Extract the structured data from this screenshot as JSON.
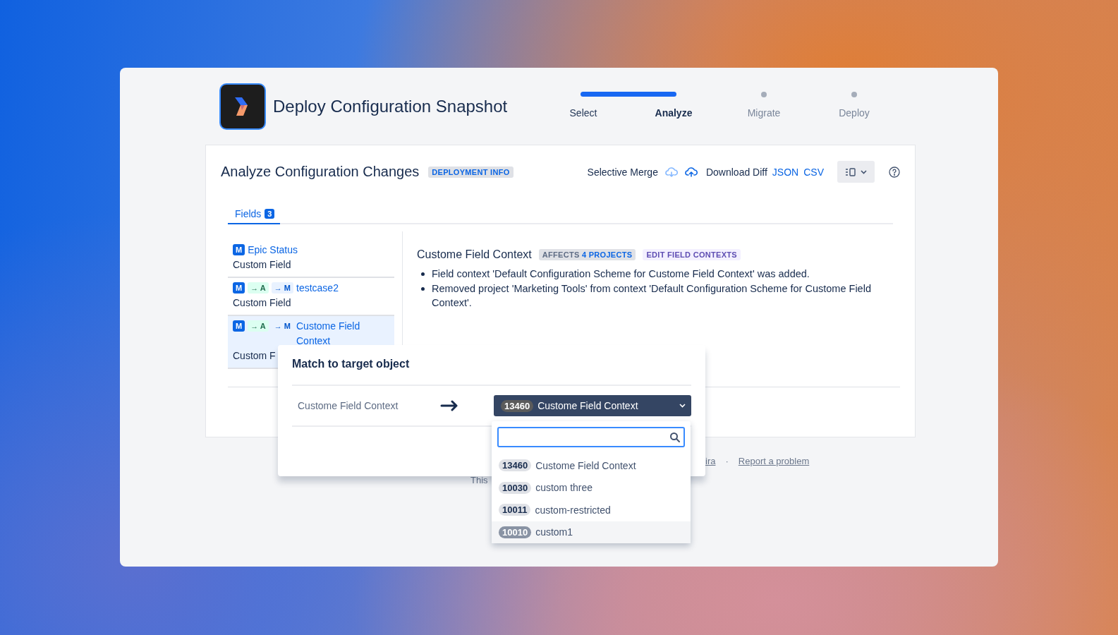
{
  "header": {
    "title": "Deploy Configuration Snapshot"
  },
  "steps": [
    {
      "label": "Select",
      "completed": true,
      "selected": false
    },
    {
      "label": "Analyze",
      "completed": false,
      "selected": true
    },
    {
      "label": "Migrate",
      "completed": false,
      "selected": false
    },
    {
      "label": "Deploy",
      "completed": false,
      "selected": false
    }
  ],
  "panel": {
    "title": "Analyze Configuration Changes",
    "badge": "DEPLOYMENT INFO",
    "merge_label": "Selective Merge",
    "merge_actions": [
      {
        "kind": "download",
        "disabled": true
      },
      {
        "kind": "upload",
        "disabled": false
      }
    ],
    "download_label": "Download Diff",
    "download_links": [
      "JSON",
      "CSV"
    ]
  },
  "tabs": [
    {
      "label": "Fields",
      "count": "3",
      "selected": true
    }
  ],
  "items": [
    {
      "tags": [
        {
          "kind": "modified",
          "label": "M"
        }
      ],
      "name": "Epic Status",
      "type": "Custom Field",
      "selected": false
    },
    {
      "tags": [
        {
          "kind": "modified",
          "label": "M"
        },
        {
          "kind": "added-target",
          "label": "→ A"
        },
        {
          "kind": "modified-target",
          "label": "→ M"
        }
      ],
      "name": "testcase2",
      "type": "Custom Field",
      "selected": false
    },
    {
      "tags": [
        {
          "kind": "modified",
          "label": "M"
        },
        {
          "kind": "added-target",
          "label": "→ A"
        },
        {
          "kind": "modified-target",
          "label": "→ M"
        }
      ],
      "name": "Custome Field Context",
      "type": "Custom F",
      "selected": true
    }
  ],
  "detail": {
    "title": "Custome Field Context",
    "affects": {
      "prefix": "AFFECTS",
      "emphasis": "4 PROJECTS"
    },
    "edit_badge": "EDIT FIELD CONTEXTS",
    "changes": [
      "Field context 'Default Configuration Scheme for Custome Field Context' was added.",
      "Removed project 'Marketing Tools' from context 'Default Configuration Scheme for Custome Field Context'."
    ]
  },
  "footer": {
    "link_fragment": "ira",
    "separator": "·",
    "report_link": "Report a problem",
    "note_fragment": "This"
  },
  "popup": {
    "title": "Match to target object",
    "source": "Custome Field Context",
    "selected_id": "13460",
    "selected_name": "Custome Field Context",
    "options": [
      {
        "id": "13460",
        "name": "Custome Field Context",
        "hovered": false
      },
      {
        "id": "10030",
        "name": "custom three",
        "hovered": false
      },
      {
        "id": "10011",
        "name": "custom-restricted",
        "hovered": false
      },
      {
        "id": "10010",
        "name": "custom1",
        "hovered": true
      }
    ]
  }
}
